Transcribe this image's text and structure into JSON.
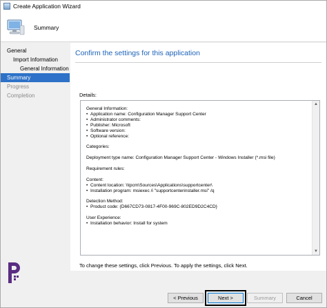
{
  "window": {
    "title": "Create Application Wizard"
  },
  "header": {
    "title": "Summary"
  },
  "sidebar": {
    "items": [
      {
        "label": "General",
        "state": "normal"
      },
      {
        "label": "Import Information",
        "state": "normal"
      },
      {
        "label": "General Information",
        "state": "normal"
      },
      {
        "label": "Summary",
        "state": "active"
      },
      {
        "label": "Progress",
        "state": "inactive"
      },
      {
        "label": "Completion",
        "state": "inactive"
      }
    ]
  },
  "main": {
    "heading": "Confirm the settings for this application",
    "details_label": "Details:",
    "details": {
      "general_info_title": "General Information:",
      "general_info_items": [
        "Application name: Configuration Manager Support Center",
        "Administrator comments:",
        "Publisher: Microsoft",
        "Software version:",
        "Optional reference:"
      ],
      "categories": "Categories:",
      "deployment_type": "Deployment type name: Configuration Manager Support Center - Windows Installer (*.msi file)",
      "requirement_rules": "Requirement rules:",
      "content_title": "Content:",
      "content_items": [
        "Content location: \\\\tpcm\\Sources\\Applications\\supportcenter\\",
        "Installation program: msiexec /i \"supportcenterinstaller.msi\" /q"
      ],
      "detection_title": "Detection Method:",
      "detection_items": [
        "Product code: {D667CD73-0817-4F00-969C-802ED9D2C4CD}"
      ],
      "user_experience_title": "User Experience:",
      "user_experience_items": [
        "Installation behavior: Install for system"
      ]
    },
    "footer_note": "To change these settings, click Previous. To apply the settings, click Next."
  },
  "buttons": {
    "previous": "< Previous",
    "next": "Next >",
    "summary": "Summary",
    "cancel": "Cancel"
  },
  "colors": {
    "accent": "#1c62b7",
    "selection": "#2d72c8",
    "logo": "#5a2d82"
  }
}
